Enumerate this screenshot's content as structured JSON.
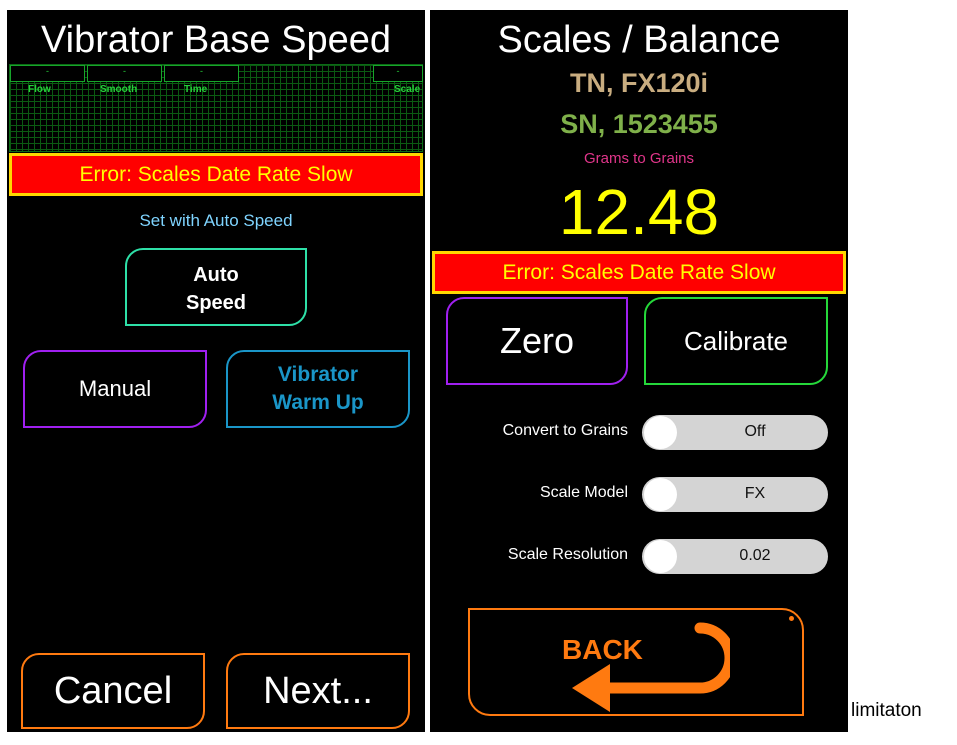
{
  "left": {
    "title": "Vibrator Base Speed",
    "graph": {
      "boxes": [
        "-",
        "-",
        "-",
        "-"
      ],
      "labels": {
        "flow": "Flow",
        "smooth": "Smooth",
        "time": "Time",
        "scale": "Scale"
      }
    },
    "error": "Error: Scales Date Rate Slow",
    "hint": "Set with Auto Speed",
    "auto_speed": {
      "line1": "Auto",
      "line2": "Speed"
    },
    "manual": "Manual",
    "warm_up": {
      "line1": "Vibrator",
      "line2": "Warm Up"
    },
    "cancel": "Cancel",
    "next": "Next..."
  },
  "right": {
    "title": "Scales / Balance",
    "tn": "TN, FX120i",
    "sn": "SN, 1523455",
    "conversion": "Grams to Grains",
    "reading": "12.48",
    "error": "Error: Scales Date Rate Slow",
    "zero": "Zero",
    "calibrate": "Calibrate",
    "settings": [
      {
        "label": "Convert to Grains",
        "value": "Off"
      },
      {
        "label": "Scale Model",
        "value": "FX"
      },
      {
        "label": "Scale Resolution",
        "value": "0.02"
      }
    ],
    "back": "BACK"
  },
  "caption": "limitaton",
  "colors": {
    "error_bg": "#ff0000",
    "error_text": "#ffff00",
    "error_border": "#ffd700",
    "teal": "#2ee0a8",
    "purple": "#a020f0",
    "blue": "#1a96c8",
    "orange": "#ff7a10",
    "green": "#25d83a",
    "tn_color": "#c9ad80",
    "sn_color": "#7fb04a",
    "pink": "#e0358a",
    "reading_color": "#ffff00"
  },
  "icons": {
    "back_arrow": "back-arrow-icon"
  }
}
